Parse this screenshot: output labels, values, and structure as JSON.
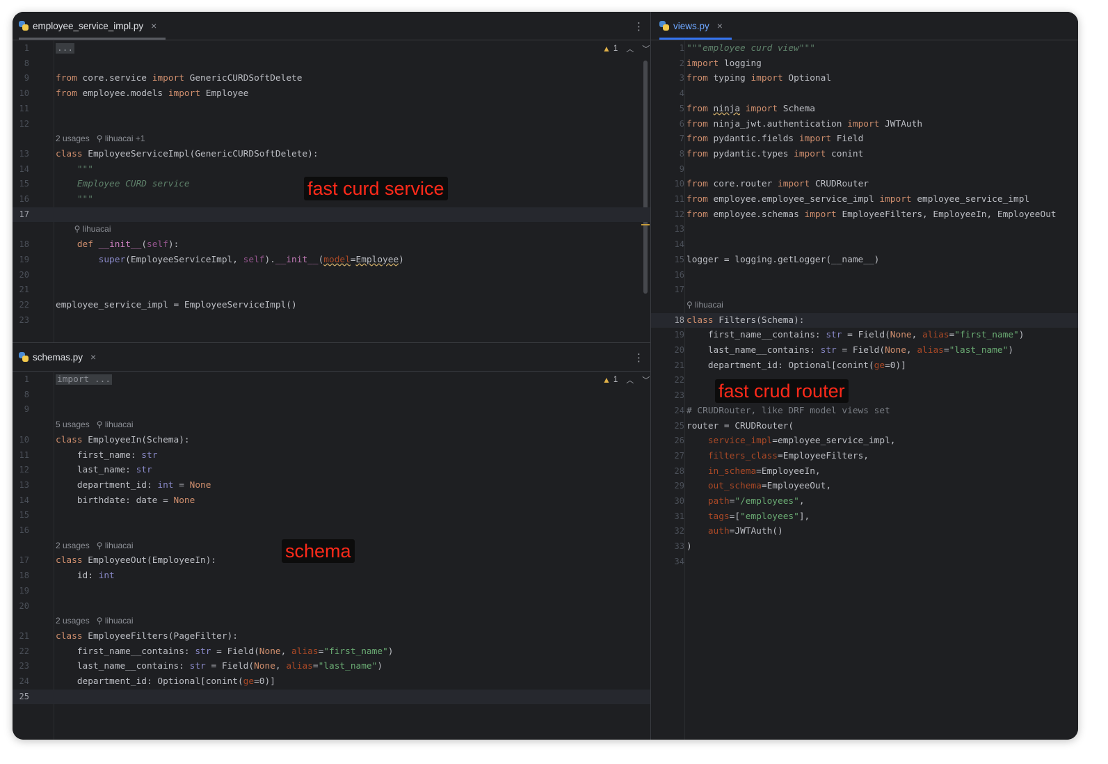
{
  "panes": {
    "top_left": {
      "tab": {
        "filename": "employee_service_impl.py",
        "close": "×"
      },
      "warnings": "1",
      "annotation": "fast curd service",
      "lines": [
        {
          "n": "1",
          "html": "<span class=\"fold\">...</span>"
        },
        {
          "n": "8",
          "html": ""
        },
        {
          "n": "9",
          "html": "<span class=\"kw\">from</span> core.service <span class=\"kw\">import</span> GenericCURDSoftDelete"
        },
        {
          "n": "10",
          "html": "<span class=\"kw\">from</span> employee.models <span class=\"kw\">import</span> Employee"
        },
        {
          "n": "11",
          "html": ""
        },
        {
          "n": "12",
          "html": ""
        },
        {
          "hint": "2 usages   ⚲ lihuacai +1"
        },
        {
          "n": "13",
          "html": "<span class=\"kw\">class</span> EmployeeServiceImpl(GenericCURDSoftDelete):"
        },
        {
          "n": "14",
          "html": "    <span class=\"doc\">\"\"\"</span>"
        },
        {
          "n": "15",
          "html": "    <span class=\"doc\">Employee CURD service</span>"
        },
        {
          "n": "16",
          "html": "    <span class=\"doc\">\"\"\"</span>"
        },
        {
          "n": "17",
          "html": "",
          "current": true
        },
        {
          "hint": "        ⚲ lihuacai"
        },
        {
          "n": "18",
          "html": "    <span class=\"kw\">def</span> <span class=\"fld\">__init__</span>(<span class=\"slf\">self</span>):"
        },
        {
          "n": "19",
          "html": "        <span class=\"bi\">super</span>(EmployeeServiceImpl, <span class=\"slf\">self</span>).<span class=\"fld\">__init__</span>(<span class=\"prm sq\">model</span>=<span class=\"sq\">Employee</span>)"
        },
        {
          "n": "20",
          "html": ""
        },
        {
          "n": "21",
          "html": ""
        },
        {
          "n": "22",
          "html": "employee_service_impl = EmployeeServiceImpl()"
        },
        {
          "n": "23",
          "html": ""
        }
      ]
    },
    "bottom_left": {
      "tab": {
        "filename": "schemas.py",
        "close": "×"
      },
      "warnings": "1",
      "annotation": "schema",
      "lines": [
        {
          "n": "1",
          "html": "<span class=\"fold\">import ...</span>"
        },
        {
          "n": "8",
          "html": ""
        },
        {
          "n": "9",
          "html": ""
        },
        {
          "hint": "5 usages   ⚲ lihuacai"
        },
        {
          "n": "10",
          "html": "<span class=\"kw\">class</span> EmployeeIn(Schema):"
        },
        {
          "n": "11",
          "html": "    first_name: <span class=\"bi\">str</span>"
        },
        {
          "n": "12",
          "html": "    last_name: <span class=\"bi\">str</span>"
        },
        {
          "n": "13",
          "html": "    department_id: <span class=\"bi\">int</span> = <span class=\"kw\">None</span>"
        },
        {
          "n": "14",
          "html": "    birthdate: date = <span class=\"kw\">None</span>"
        },
        {
          "n": "15",
          "html": ""
        },
        {
          "n": "16",
          "html": ""
        },
        {
          "hint": "2 usages   ⚲ lihuacai"
        },
        {
          "n": "17",
          "html": "<span class=\"kw\">class</span> EmployeeOut(EmployeeIn):"
        },
        {
          "n": "18",
          "html": "    id: <span class=\"bi\">int</span>"
        },
        {
          "n": "19",
          "html": ""
        },
        {
          "n": "20",
          "html": ""
        },
        {
          "hint": "2 usages   ⚲ lihuacai"
        },
        {
          "n": "21",
          "html": "<span class=\"kw\">class</span> EmployeeFilters(PageFilter):"
        },
        {
          "n": "22",
          "html": "    first_name__contains: <span class=\"bi\">str</span> = Field(<span class=\"kw\">None</span>, <span class=\"prm\">alias</span>=<span class=\"str\">\"first_name\"</span>)"
        },
        {
          "n": "23",
          "html": "    last_name__contains: <span class=\"bi\">str</span> = Field(<span class=\"kw\">None</span>, <span class=\"prm\">alias</span>=<span class=\"str\">\"last_name\"</span>)"
        },
        {
          "n": "24",
          "html": "    department_id: Optional[conint(<span class=\"prm\">ge</span>=0)]"
        },
        {
          "n": "25",
          "html": "",
          "current": true
        }
      ]
    },
    "right": {
      "tab": {
        "filename": "views.py",
        "close": "×"
      },
      "annotation": "fast crud router",
      "lines": [
        {
          "n": "1",
          "html": "<span class=\"doc\">\"\"\"employee curd view\"\"\"</span>"
        },
        {
          "n": "2",
          "html": "<span class=\"kw\">import</span> logging"
        },
        {
          "n": "3",
          "html": "<span class=\"kw\">from</span> typing <span class=\"kw\">import</span> Optional"
        },
        {
          "n": "4",
          "html": ""
        },
        {
          "n": "5",
          "html": "<span class=\"kw\">from</span> <span class=\"sq\">ninja</span> <span class=\"kw\">import</span> Schema"
        },
        {
          "n": "6",
          "html": "<span class=\"kw\">from</span> ninja_jwt.authentication <span class=\"kw\">import</span> JWTAuth"
        },
        {
          "n": "7",
          "html": "<span class=\"kw\">from</span> pydantic.fields <span class=\"kw\">import</span> Field"
        },
        {
          "n": "8",
          "html": "<span class=\"kw\">from</span> pydantic.types <span class=\"kw\">import</span> conint"
        },
        {
          "n": "9",
          "html": ""
        },
        {
          "n": "10",
          "html": "<span class=\"kw\">from</span> core.router <span class=\"kw\">import</span> CRUDRouter"
        },
        {
          "n": "11",
          "html": "<span class=\"kw\">from</span> employee.employee_service_impl <span class=\"kw\">import</span> employee_service_impl"
        },
        {
          "n": "12",
          "html": "<span class=\"kw\">from</span> employee.schemas <span class=\"kw\">import</span> EmployeeFilters, EmployeeIn, EmployeeOut"
        },
        {
          "n": "13",
          "html": ""
        },
        {
          "n": "14",
          "html": ""
        },
        {
          "n": "15",
          "html": "logger = logging.getLogger(__name__)"
        },
        {
          "n": "16",
          "html": ""
        },
        {
          "n": "17",
          "html": ""
        },
        {
          "hint": "⚲ lihuacai"
        },
        {
          "n": "18",
          "html": "<span class=\"kw\">class</span> Filters(Schema):",
          "current": true
        },
        {
          "n": "19",
          "html": "    first_name__contains: <span class=\"bi\">str</span> = Field(<span class=\"kw\">None</span>, <span class=\"prm\">alias</span>=<span class=\"str\">\"first_name\"</span>)"
        },
        {
          "n": "20",
          "html": "    last_name__contains: <span class=\"bi\">str</span> = Field(<span class=\"kw\">None</span>, <span class=\"prm\">alias</span>=<span class=\"str\">\"last_name\"</span>)"
        },
        {
          "n": "21",
          "html": "    department_id: Optional[conint(<span class=\"prm\">ge</span>=0)]"
        },
        {
          "n": "22",
          "html": ""
        },
        {
          "n": "23",
          "html": ""
        },
        {
          "n": "24",
          "html": "<span class=\"cm\"># CRUDRouter, like DRF model views set</span>"
        },
        {
          "n": "25",
          "html": "router = CRUDRouter("
        },
        {
          "n": "26",
          "html": "    <span class=\"prm\">service_impl</span>=employee_service_impl,"
        },
        {
          "n": "27",
          "html": "    <span class=\"prm\">filters_class</span>=EmployeeFilters,"
        },
        {
          "n": "28",
          "html": "    <span class=\"prm\">in_schema</span>=EmployeeIn,"
        },
        {
          "n": "29",
          "html": "    <span class=\"prm\">out_schema</span>=EmployeeOut,"
        },
        {
          "n": "30",
          "html": "    <span class=\"prm\">path</span>=<span class=\"str\">\"/employees\"</span>,"
        },
        {
          "n": "31",
          "html": "    <span class=\"prm\">tags</span>=[<span class=\"str\">\"employees\"</span>],"
        },
        {
          "n": "32",
          "html": "    <span class=\"prm\">auth</span>=JWTAuth()"
        },
        {
          "n": "33",
          "html": ")"
        },
        {
          "n": "34",
          "html": ""
        }
      ]
    }
  }
}
